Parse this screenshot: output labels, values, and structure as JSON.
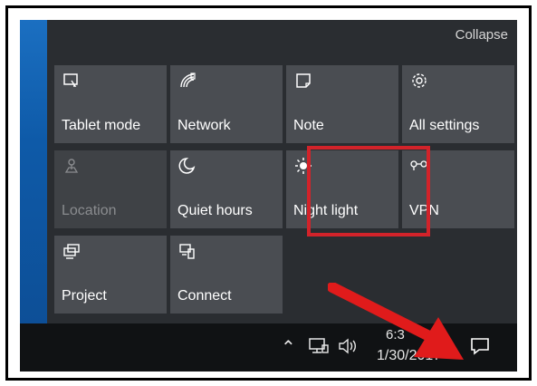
{
  "panel": {
    "collapse_label": "Collapse"
  },
  "tiles": [
    {
      "label": "Tablet mode",
      "icon": "tablet-mode-icon"
    },
    {
      "label": "Network",
      "icon": "network-icon"
    },
    {
      "label": "Note",
      "icon": "note-icon"
    },
    {
      "label": "All settings",
      "icon": "gear-icon"
    },
    {
      "label": "Location",
      "icon": "location-icon",
      "state": "disabled"
    },
    {
      "label": "Quiet hours",
      "icon": "moon-icon"
    },
    {
      "label": "Night light",
      "icon": "sun-icon",
      "highlighted": true
    },
    {
      "label": "VPN",
      "icon": "vpn-icon"
    },
    {
      "label": "Project",
      "icon": "project-icon"
    },
    {
      "label": "Connect",
      "icon": "connect-icon"
    }
  ],
  "taskbar": {
    "time": "6:3",
    "date": "1/30/2017"
  },
  "colors": {
    "highlight": "#d2232a",
    "arrow": "#e01b1b",
    "tile_bg": "#4a4d52"
  }
}
